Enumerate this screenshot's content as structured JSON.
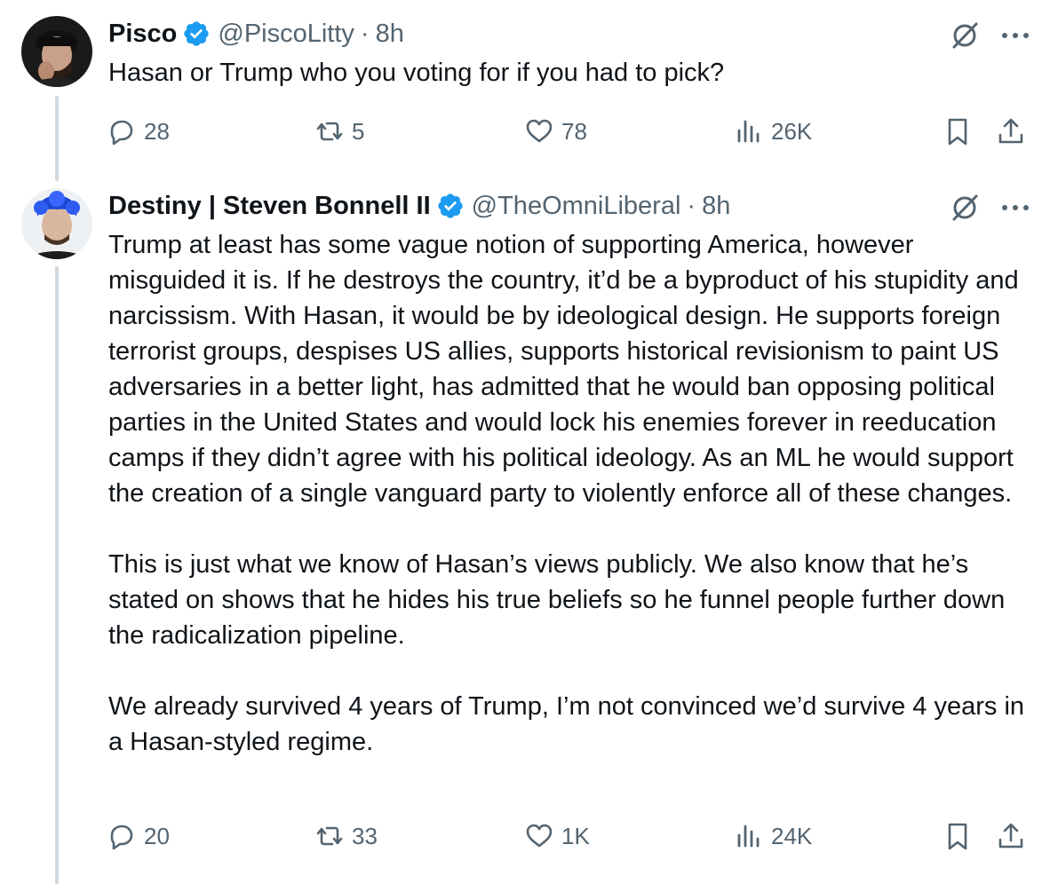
{
  "tweets": [
    {
      "display_name": "Pisco",
      "verified": true,
      "handle": "@PiscoLitty",
      "separator": "·",
      "time": "8h",
      "text": "Hasan or Trump who you voting for if you had to pick?",
      "stats": {
        "replies": "28",
        "reposts": "5",
        "likes": "78",
        "views": "26K"
      }
    },
    {
      "display_name": "Destiny | Steven Bonnell II",
      "verified": true,
      "handle": "@TheOmniLiberal",
      "separator": "·",
      "time": "8h",
      "text": "Trump at least has some vague notion of supporting America, however misguided it is. If he destroys the country, it’d be a byproduct of his stupidity and narcissism. With Hasan, it would be by ideological design. He supports foreign terrorist groups, despises US allies, supports historical revisionism to paint US adversaries in a better light, has admitted that he would ban opposing political parties in the United States and would lock his enemies forever in reeducation camps if they didn’t agree with his political ideology. As an ML he would support the creation of a single vanguard party to violently enforce all of these changes.\n\nThis is just what we know of Hasan’s views publicly. We also know that he’s stated on shows that he hides his true beliefs so he funnel people further down the radicalization pipeline.\n\nWe already survived 4 years of Trump, I’m not convinced we’d survive 4 years in a Hasan-styled regime.",
      "stats": {
        "replies": "20",
        "reposts": "33",
        "likes": "1K",
        "views": "24K"
      }
    }
  ],
  "colors": {
    "text": "#0f1419",
    "secondary": "#536471",
    "verified_blue": "#1d9bf0",
    "thread_line": "#cfd9de"
  },
  "icons": [
    "reply-icon",
    "repost-icon",
    "like-icon",
    "views-icon",
    "bookmark-icon",
    "share-icon",
    "grok-icon",
    "more-icon",
    "verified-badge-icon"
  ]
}
